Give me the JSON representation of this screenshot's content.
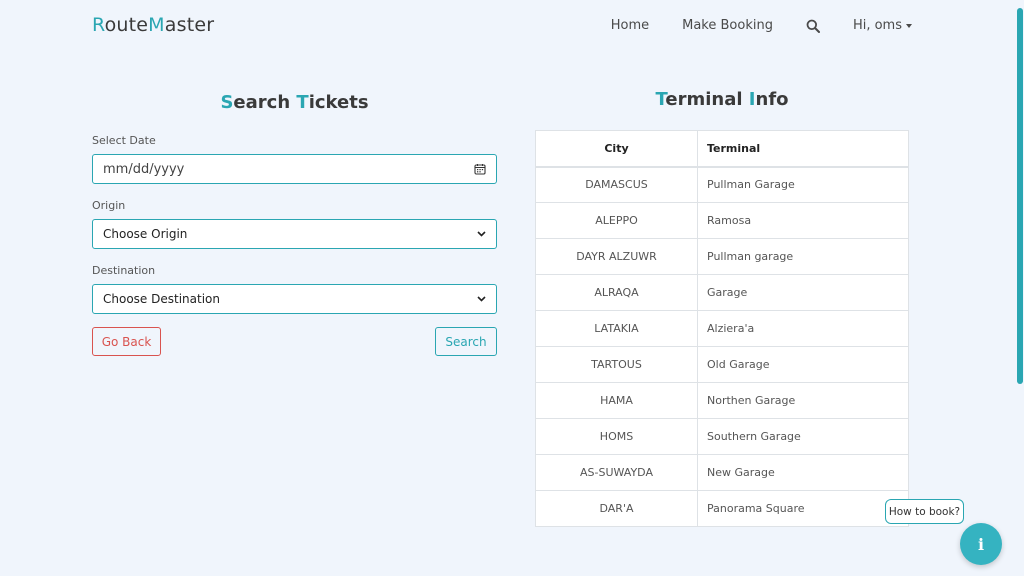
{
  "brand": {
    "first_letter": "R",
    "part1": "oute",
    "second_letter": "M",
    "part2": "aster"
  },
  "nav": {
    "home": "Home",
    "make_booking": "Make Booking",
    "search_icon": "search-icon",
    "user_greeting": "Hi, oms"
  },
  "search_form": {
    "title_first": "S",
    "title_word1_rest": "earch ",
    "title_second": "T",
    "title_word2_rest": "ickets",
    "date_label": "Select Date",
    "date_placeholder": "mm/dd/yyyy",
    "origin_label": "Origin",
    "origin_value": "Choose Origin",
    "destination_label": "Destination",
    "destination_value": "Choose Destination",
    "back_button": "Go Back",
    "search_button": "Search"
  },
  "terminal_info": {
    "title_first": "T",
    "title_word1_rest": "erminal ",
    "title_second": "I",
    "title_word2_rest": "nfo",
    "headers": [
      "City",
      "Terminal"
    ],
    "rows": [
      [
        "DAMASCUS",
        "Pullman Garage"
      ],
      [
        "ALEPPO",
        "Ramosa"
      ],
      [
        "DAYR ALZUWR",
        "Pullman garage"
      ],
      [
        "ALRAQA",
        "Garage"
      ],
      [
        "LATAKIA",
        "Alziera'a"
      ],
      [
        "TARTOUS",
        "Old Garage"
      ],
      [
        "HAMA",
        "Northen Garage"
      ],
      [
        "HOMS",
        "Southern Garage"
      ],
      [
        "AS-SUWAYDA",
        "New Garage"
      ],
      [
        "DAR'A",
        "Panorama Square"
      ]
    ]
  },
  "help": {
    "bubble_text": "How to book?",
    "icon": "info-icon",
    "glyph": "i"
  },
  "colors": {
    "accent": "#2aa6b2",
    "danger": "#d9534f",
    "background": "#f0f5fc"
  }
}
